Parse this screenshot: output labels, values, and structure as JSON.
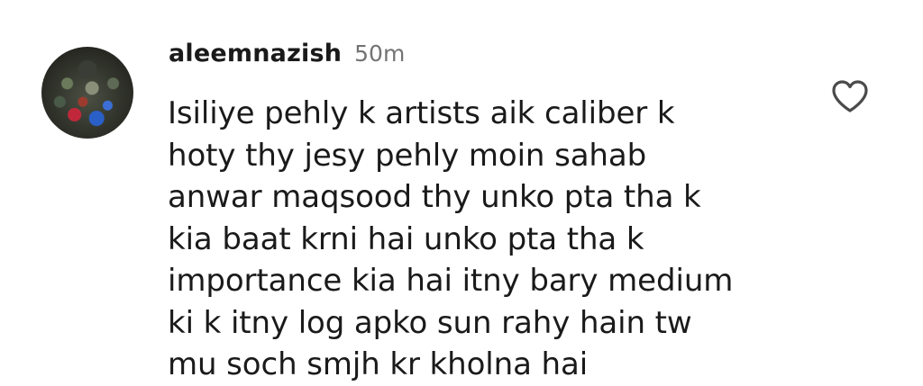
{
  "comment": {
    "username": "aleemnazish",
    "timestamp": "50m",
    "lines": [
      "Isiliye pehly k artists aik caliber k",
      "hoty thy jesy pehly moin sahab",
      "anwar maqsood thy unko pta tha k",
      "kia baat krni hai unko pta tha k",
      "importance kia hai itny bary medium",
      "ki k itny log apko sun rahy hain tw",
      "mu soch smjh kr kholna hai"
    ],
    "like_icon": "heart-outline-icon",
    "liked": false
  },
  "colors": {
    "text": "#1a1a1a",
    "timestamp": "#737373",
    "icon": "#4a4a4a",
    "background": "#ffffff"
  }
}
